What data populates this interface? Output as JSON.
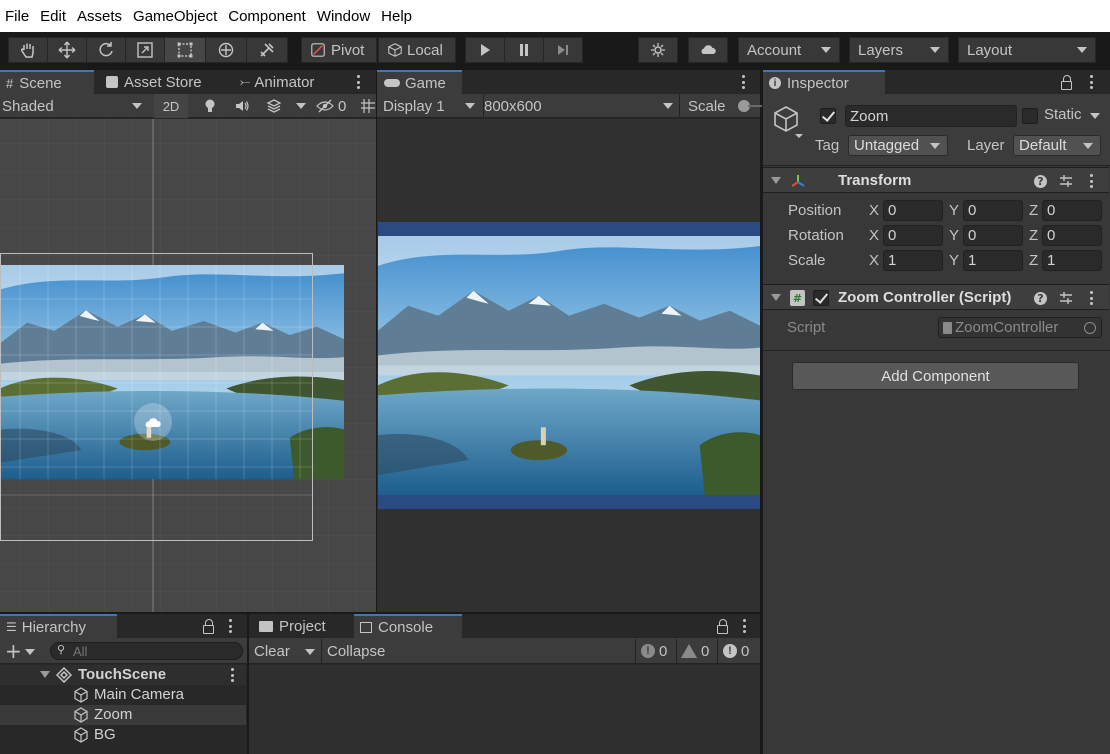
{
  "menu": [
    "File",
    "Edit",
    "Assets",
    "GameObject",
    "Component",
    "Window",
    "Help"
  ],
  "toolbar": {
    "pivot_label": "Pivot",
    "local_label": "Local",
    "account_label": "Account",
    "layers_label": "Layers",
    "layout_label": "Layout"
  },
  "scene_panel": {
    "tabs": [
      "Scene",
      "Asset Store",
      "Animator"
    ],
    "shading": "Shaded",
    "mode_2d": "2D",
    "hidden_count": "0"
  },
  "game_panel": {
    "tab": "Game",
    "display": "Display 1",
    "resolution": "800x600",
    "scale_label": "Scale"
  },
  "inspector": {
    "tab": "Inspector",
    "object_name": "Zoom",
    "static_label": "Static",
    "tag_label": "Tag",
    "tag_value": "Untagged",
    "layer_label": "Layer",
    "layer_value": "Default",
    "transform": {
      "title": "Transform",
      "rows": [
        {
          "label": "Position",
          "x": "0",
          "y": "0",
          "z": "0"
        },
        {
          "label": "Rotation",
          "x": "0",
          "y": "0",
          "z": "0"
        },
        {
          "label": "Scale",
          "x": "1",
          "y": "1",
          "z": "1"
        }
      ],
      "axis": [
        "X",
        "Y",
        "Z"
      ]
    },
    "script_component": {
      "title": "Zoom Controller (Script)",
      "script_label": "Script",
      "script_value": "ZoomController"
    },
    "add_component": "Add Component"
  },
  "hierarchy": {
    "tab": "Hierarchy",
    "search_placeholder": "All",
    "scene": "TouchScene",
    "items": [
      "Main Camera",
      "Zoom",
      "BG"
    ]
  },
  "bottom_tabs": {
    "project": "Project",
    "console": "Console"
  },
  "console": {
    "clear": "Clear",
    "collapse": "Collapse",
    "log_count": "0",
    "warn_count": "0",
    "error_count": "0"
  },
  "colors": {
    "accent": "#3a79bb",
    "panel_bg": "#282828",
    "game_bg": "#2b4a82"
  }
}
